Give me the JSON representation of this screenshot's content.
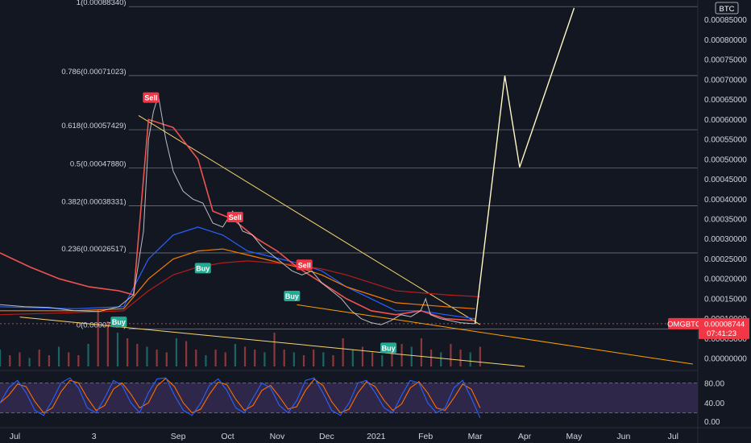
{
  "chart_data": {
    "type": "line",
    "instrument": "OMGBTC",
    "currency_tag": "BTC",
    "last_price": "0.00008744",
    "countdown": "07:41:23",
    "price_axis": {
      "range": [
        -2e-05,
        0.0009
      ],
      "ticks": [
        "0.00085000",
        "0.00080000",
        "0.00075000",
        "0.00070000",
        "0.00065000",
        "0.00060000",
        "0.00055000",
        "0.00050000",
        "0.00045000",
        "0.00040000",
        "0.00035000",
        "0.00030000",
        "0.00025000",
        "0.00020000",
        "0.00015000",
        "0.00010000",
        "0.00005000",
        "0.00000000"
      ]
    },
    "time_axis": {
      "labels": [
        "Jul",
        "3",
        "Sep",
        "Oct",
        "Nov",
        "Dec",
        "2021",
        "Feb",
        "Mar",
        "Apr",
        "May",
        "Jun",
        "Jul"
      ],
      "positions": [
        0.3,
        1.9,
        3.6,
        4.6,
        5.6,
        6.6,
        7.6,
        8.6,
        9.6,
        10.6,
        11.6,
        12.6,
        13.6
      ]
    },
    "fib_levels": [
      {
        "label": "1(0.00088340)",
        "value": 0.0008834
      },
      {
        "label": "0.786(0.00071023)",
        "value": 0.00071023
      },
      {
        "label": "0.618(0.00057429)",
        "value": 0.00057429
      },
      {
        "label": "0.5(0.00047880)",
        "value": 0.0004788
      },
      {
        "label": "0.382(0.00038331)",
        "value": 0.00038331
      },
      {
        "label": "0.236(0.00026517)",
        "value": 0.00026517
      },
      {
        "label": "0(0.00007420)",
        "value": 7.42e-05
      }
    ],
    "price_series": {
      "name": "OMGBTC",
      "color": "#ef5350",
      "points": [
        [
          0,
          0.000135
        ],
        [
          0.5,
          0.00013
        ],
        [
          1.0,
          0.000128
        ],
        [
          1.5,
          0.00012
        ],
        [
          2.0,
          0.000118
        ],
        [
          2.4,
          0.00013
        ],
        [
          2.7,
          0.00016
        ],
        [
          2.9,
          0.00032
        ],
        [
          3.0,
          0.00055
        ],
        [
          3.1,
          0.00062
        ],
        [
          3.2,
          0.00066
        ],
        [
          3.35,
          0.00055
        ],
        [
          3.5,
          0.00047
        ],
        [
          3.7,
          0.00042
        ],
        [
          3.9,
          0.0004
        ],
        [
          4.1,
          0.00039
        ],
        [
          4.3,
          0.00034
        ],
        [
          4.5,
          0.00033
        ],
        [
          4.7,
          0.00037
        ],
        [
          4.9,
          0.00032
        ],
        [
          5.1,
          0.00031
        ],
        [
          5.3,
          0.00028
        ],
        [
          5.5,
          0.00026
        ],
        [
          5.7,
          0.00024
        ],
        [
          5.9,
          0.00022
        ],
        [
          6.1,
          0.00021
        ],
        [
          6.3,
          0.00022
        ],
        [
          6.5,
          0.00019
        ],
        [
          6.7,
          0.00017
        ],
        [
          6.9,
          0.00015
        ],
        [
          7.1,
          0.00012
        ],
        [
          7.3,
          0.0001
        ],
        [
          7.5,
          9e-05
        ],
        [
          7.7,
          8.5e-05
        ],
        [
          7.9,
          9.5e-05
        ],
        [
          8.1,
          0.00011
        ],
        [
          8.3,
          0.000105
        ],
        [
          8.5,
          0.00012
        ],
        [
          8.6,
          0.00015
        ],
        [
          8.7,
          0.00011
        ],
        [
          8.9,
          0.0001
        ],
        [
          9.1,
          9.5e-05
        ],
        [
          9.3,
          9e-05
        ],
        [
          9.5,
          8.8e-05
        ],
        [
          9.6,
          8.74e-05
        ]
      ]
    },
    "moving_averages": [
      {
        "color": "#2962ff",
        "points": [
          [
            0,
            0.00013
          ],
          [
            1.5,
            0.000125
          ],
          [
            2.5,
            0.00013
          ],
          [
            3.0,
            0.00025
          ],
          [
            3.5,
            0.00031
          ],
          [
            4.0,
            0.00033
          ],
          [
            4.5,
            0.00031
          ],
          [
            5.0,
            0.00027
          ],
          [
            5.5,
            0.000255
          ],
          [
            6.0,
            0.00024
          ],
          [
            6.5,
            0.00022
          ],
          [
            7.0,
            0.00018
          ],
          [
            7.5,
            0.00015
          ],
          [
            8.0,
            0.00012
          ],
          [
            8.5,
            0.00012
          ],
          [
            9.0,
            0.00011
          ],
          [
            9.6,
            0.0001
          ]
        ]
      },
      {
        "color": "#f57c00",
        "points": [
          [
            0,
            0.00012
          ],
          [
            1.5,
            0.00012
          ],
          [
            2.5,
            0.000125
          ],
          [
            3.0,
            0.0002
          ],
          [
            3.5,
            0.00025
          ],
          [
            4.0,
            0.00027
          ],
          [
            4.5,
            0.000275
          ],
          [
            5.0,
            0.00026
          ],
          [
            5.5,
            0.000245
          ],
          [
            6.0,
            0.00023
          ],
          [
            6.5,
            0.00021
          ],
          [
            7.0,
            0.00018
          ],
          [
            7.5,
            0.00016
          ],
          [
            8.0,
            0.00014
          ],
          [
            8.5,
            0.000135
          ],
          [
            9.0,
            0.00013
          ],
          [
            9.6,
            0.000125
          ]
        ]
      },
      {
        "color": "#b71c1c",
        "points": [
          [
            0,
            0.00011
          ],
          [
            1.5,
            0.000115
          ],
          [
            2.5,
            0.00012
          ],
          [
            3.0,
            0.00017
          ],
          [
            3.5,
            0.00021
          ],
          [
            4.0,
            0.00023
          ],
          [
            4.5,
            0.00024
          ],
          [
            5.0,
            0.000245
          ],
          [
            5.5,
            0.00024
          ],
          [
            6.0,
            0.000235
          ],
          [
            6.5,
            0.000225
          ],
          [
            7.0,
            0.00021
          ],
          [
            7.5,
            0.00019
          ],
          [
            8.0,
            0.00017
          ],
          [
            8.5,
            0.000165
          ],
          [
            9.0,
            0.00016
          ],
          [
            9.7,
            0.000155
          ]
        ]
      }
    ],
    "supertrend": {
      "color": "#ef5350",
      "points": [
        [
          0,
          0.000265
        ],
        [
          0.6,
          0.00023
        ],
        [
          1.2,
          0.0002
        ],
        [
          1.8,
          0.00018
        ],
        [
          2.4,
          0.00017
        ],
        [
          2.7,
          0.00016
        ],
        [
          3.0,
          0.0006
        ],
        [
          3.5,
          0.00058
        ],
        [
          4.0,
          0.0005
        ],
        [
          4.3,
          0.00037
        ],
        [
          4.7,
          0.00035
        ],
        [
          5.2,
          0.0003
        ],
        [
          5.6,
          0.00027
        ],
        [
          6.0,
          0.00023
        ],
        [
          6.5,
          0.00019
        ],
        [
          7.0,
          0.00015
        ],
        [
          7.5,
          0.00012
        ],
        [
          8.0,
          0.00011
        ],
        [
          8.5,
          0.00012
        ],
        [
          9.0,
          0.0001
        ],
        [
          9.6,
          9.5e-05
        ]
      ]
    },
    "trendlines": [
      {
        "color": "#f9d56e",
        "from": [
          2.8,
          0.00061
        ],
        "to": [
          9.7,
          8.5e-05
        ]
      },
      {
        "color": "#f9d56e",
        "from": [
          0.4,
          0.000104
        ],
        "to": [
          10.6,
          -2e-05
        ]
      },
      {
        "color": "#ffa000",
        "from": [
          6.0,
          0.000135
        ],
        "to": [
          14.0,
          -1.4e-05
        ]
      }
    ],
    "projection": {
      "color": "#fff9c4",
      "points": [
        [
          9.6,
          8.74e-05
        ],
        [
          10.2,
          0.00071
        ],
        [
          10.5,
          0.00048
        ],
        [
          11.6,
          0.00088
        ]
      ]
    },
    "signals": [
      {
        "label": "Sell",
        "type": "sell",
        "x": 3.05,
        "value": 0.00064
      },
      {
        "label": "Sell",
        "type": "sell",
        "x": 4.75,
        "value": 0.00034
      },
      {
        "label": "Sell",
        "type": "sell",
        "x": 6.15,
        "value": 0.00022
      },
      {
        "label": "Buy",
        "type": "buy",
        "x": 2.4,
        "value": 0.000105
      },
      {
        "label": "Buy",
        "type": "buy",
        "x": 4.1,
        "value": 0.00024
      },
      {
        "label": "Buy",
        "type": "buy",
        "x": 5.9,
        "value": 0.00017
      },
      {
        "label": "Buy",
        "type": "buy",
        "x": 7.85,
        "value": 4e-05
      }
    ],
    "volume": [
      0.3,
      0.2,
      0.25,
      0.15,
      0.3,
      0.2,
      0.35,
      0.25,
      0.2,
      0.4,
      1.0,
      0.8,
      0.6,
      0.5,
      0.4,
      0.35,
      0.3,
      0.25,
      0.5,
      0.45,
      0.3,
      0.2,
      0.3,
      0.25,
      0.4,
      0.35,
      0.3,
      0.25,
      0.6,
      0.3,
      0.25,
      0.2,
      0.3,
      0.25,
      0.2,
      0.5,
      0.3,
      0.35,
      0.25,
      0.2,
      0.3,
      0.4,
      0.35,
      0.5,
      0.3,
      0.25,
      0.4,
      0.3,
      0.25,
      0.35
    ],
    "oscillator": {
      "ticks": [
        "80.00",
        "40.00",
        "0.00"
      ],
      "upper": 80,
      "lower": 20,
      "k_color": "#2962ff",
      "d_color": "#ff6d00",
      "values": [
        40,
        70,
        85,
        60,
        25,
        15,
        45,
        80,
        90,
        70,
        30,
        20,
        50,
        85,
        75,
        40,
        20,
        60,
        88,
        90,
        55,
        25,
        15,
        40,
        75,
        88,
        65,
        30,
        20,
        50,
        80,
        70,
        35,
        20,
        45,
        85,
        90,
        60,
        25,
        15,
        40,
        80,
        85,
        60,
        30,
        20,
        55,
        85,
        80,
        40,
        20,
        30,
        70,
        85,
        50,
        10
      ]
    }
  }
}
